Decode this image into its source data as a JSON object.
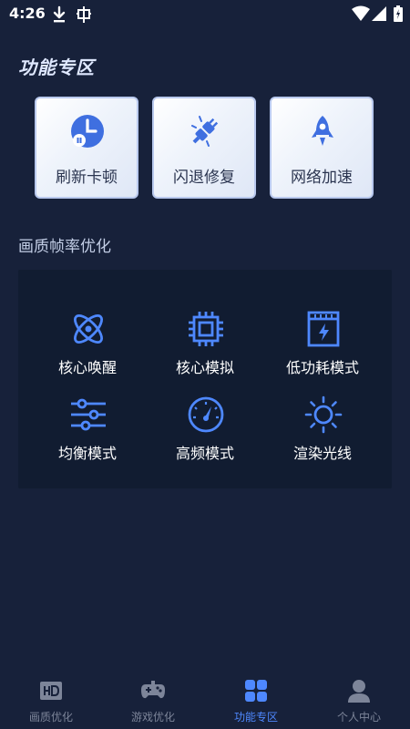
{
  "status_bar": {
    "time": "4:26",
    "left_icons": [
      "download-icon",
      "bug-icon"
    ],
    "right_icons": [
      "wifi-icon",
      "signal-icon",
      "battery-icon"
    ]
  },
  "header": {
    "title": "功能专区"
  },
  "features": [
    {
      "label": "刷新卡顿",
      "icon": "clock-icon"
    },
    {
      "label": "闪退修复",
      "icon": "plug-icon"
    },
    {
      "label": "网络加速",
      "icon": "rocket-icon"
    }
  ],
  "optimize": {
    "title": "画质帧率优化",
    "options": [
      {
        "label": "核心唤醒",
        "icon": "atom-icon"
      },
      {
        "label": "核心模拟",
        "icon": "chip-icon"
      },
      {
        "label": "低功耗模式",
        "icon": "battery-bolt-icon"
      },
      {
        "label": "均衡模式",
        "icon": "sliders-icon"
      },
      {
        "label": "高频模式",
        "icon": "gauge-icon"
      },
      {
        "label": "渲染光线",
        "icon": "sun-icon"
      }
    ]
  },
  "nav": {
    "items": [
      {
        "label": "画质优化",
        "icon": "hd-icon",
        "active": false
      },
      {
        "label": "游戏优化",
        "icon": "gamepad-icon",
        "active": false
      },
      {
        "label": "功能专区",
        "icon": "grid-icon",
        "active": true
      },
      {
        "label": "个人中心",
        "icon": "user-icon",
        "active": false
      }
    ]
  },
  "colors": {
    "background": "#17213a",
    "panel": "#111c31",
    "accent": "#4e88ff",
    "inactive_nav": "#7d8599"
  }
}
